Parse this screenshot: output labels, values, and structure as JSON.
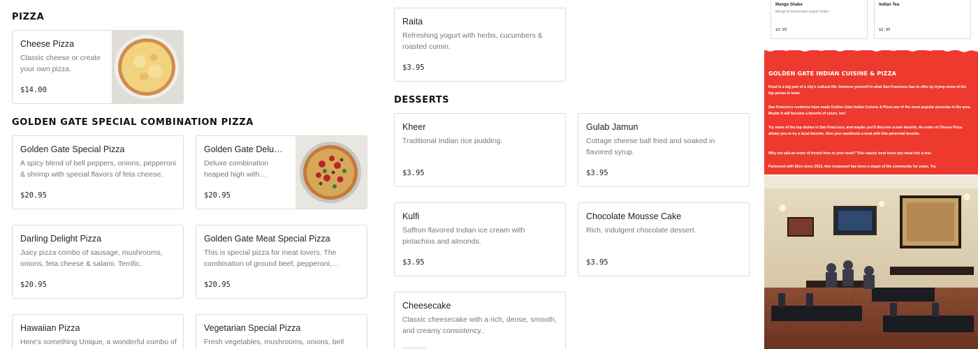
{
  "sections": {
    "pizza": "PIZZA",
    "combo": "GOLDEN GATE SPECIAL COMBINATION PIZZA",
    "desserts": "DESSERTS"
  },
  "pizza_items": [
    {
      "name": "Cheese Pizza",
      "desc": "Classic cheese or create your own pizza.",
      "price": "$14.00"
    }
  ],
  "combo_items": [
    {
      "name": "Golden Gate Special Pizza",
      "desc": "A spicy blend of bell peppers, onions, pepperoni & shrimp with special flavors of feta cheese.",
      "price": "$20.95"
    },
    {
      "name": "Golden Gate Deluxe Pizza",
      "desc": "Deluxe combination heaped high with sausage, mushrooms and more.",
      "price": "$20.95"
    },
    {
      "name": "Darling Delight Pizza",
      "desc": "Juicy pizza combo of sausage, mushrooms, onions, feta cheese & salami. Terrific.",
      "price": "$20.95"
    },
    {
      "name": "Golden Gate Meat Special Pizza",
      "desc": "This is special pizza for meat lovers. The combination of ground beef, pepperoni, sausage and more.",
      "price": "$20.95"
    },
    {
      "name": "Hawaiian Pizza",
      "desc": "Here's something Unique, a wonderful combo of",
      "price": ""
    },
    {
      "name": "Vegetarian Special Pizza",
      "desc": "Fresh vegetables, mushrooms, onions, bell",
      "price": ""
    }
  ],
  "raita": {
    "name": "Raita",
    "desc": "Refreshing yogurt with herbs, cucumbers & roasted cumin.",
    "price": "$3.95"
  },
  "dessert_items": [
    {
      "name": "Kheer",
      "desc": "Traditional Indian rice pudding.",
      "price": "$3.95"
    },
    {
      "name": "Gulab Jamun",
      "desc": "Cottage cheese ball fried and soaked in flavored syrup.",
      "price": "$3.95"
    },
    {
      "name": "Kulfi",
      "desc": "Saffron flavored Indian ice cream with pistachios and almonds.",
      "price": "$3.95"
    },
    {
      "name": "Chocolate Mousse Cake",
      "desc": "Rich, indulgent chocolate dessert.",
      "price": "$3.95"
    },
    {
      "name": "Cheesecake",
      "desc": "Classic cheesecake with a rich, dense, smooth, and creamy consistency..",
      "price": ""
    }
  ],
  "drinks": [
    {
      "name": "Mango Shake",
      "desc": "Mango & homemade yogurt shake.",
      "price": "$3.95"
    },
    {
      "name": "Indian Tea",
      "desc": "",
      "price": "$2.95"
    }
  ],
  "info": {
    "title": "GOLDEN GATE INDIAN CUISINE & PIZZA",
    "p1": "Food is a big part of a city's cultural life. Immerse yourself in what San Francisco has to offer by trying some of the top pizzas in town.",
    "p2": "San Francisco residents have made Golden Gate Indian Cuisine & Pizza one of the most popular pizzerias in the area. Maybe it will become a favorite of yours, too!",
    "p3": "Try some of the top dishes in San Francisco, and maybe you'll discover a new favorite. An order of Cheese Pizza allows you to try a local favorite. Give your tastebuds a treat with this perennial favorite.",
    "p4": "Why not add an order of french fries to your meal? This classic treat turns any meal into a fest.",
    "p5": "Partnered with Slice since 2013, this restaurant has been a staple of the community for years. Try"
  },
  "colors": {
    "accent_red": "#ee3a2e",
    "card_border": "#dcdcdc",
    "muted_text": "#777777"
  }
}
